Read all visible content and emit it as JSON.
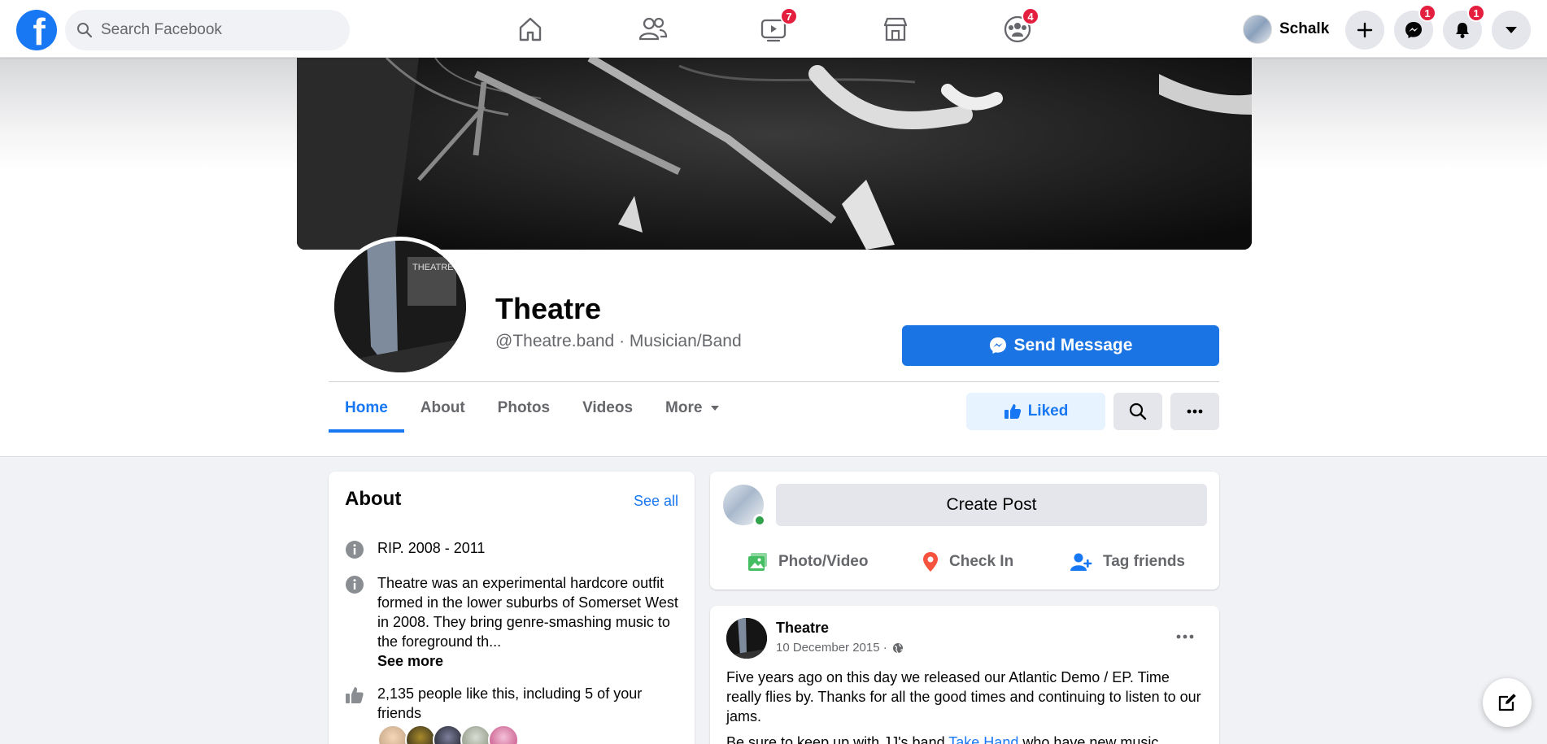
{
  "topnav": {
    "logo_letter": "f",
    "search_placeholder": "Search Facebook",
    "watch_badge": "7",
    "groups_badge": "4",
    "user_name": "Schalk",
    "messenger_badge": "1",
    "notifications_badge": "1"
  },
  "profile": {
    "name": "Theatre",
    "subtitle": "@Theatre.band · Musician/Band",
    "send_message": "Send Message",
    "cover_tag": "THEATRE"
  },
  "tabs": [
    "Home",
    "About",
    "Photos",
    "Videos",
    "More"
  ],
  "actions": {
    "liked": "Liked"
  },
  "about": {
    "title": "About",
    "see_all": "See all",
    "rip": "RIP. 2008 - 2011",
    "description": "Theatre was an experimental hardcore outfit formed in the lower suburbs of Somerset West in 2008. They bring genre-smashing music to the foreground th...",
    "see_more": "See more",
    "likes": "2,135 people like this, including 5 of your friends"
  },
  "composer": {
    "create_post": "Create Post",
    "photo_video": "Photo/Video",
    "check_in": "Check In",
    "tag_friends": "Tag friends"
  },
  "post": {
    "author": "Theatre",
    "date": "10 December 2015 ·",
    "text_line": "Five years ago on this day we released our Atlantic Demo / EP. Time really flies by. Thanks for all the good times and continuing to listen to our jams.",
    "text_2a": "Be sure to keep up with JJ's band ",
    "text_2_link": "Take Hand",
    "text_2b": " who have new music"
  },
  "colors": {
    "brand": "#1877f2",
    "badge": "#e41e3f",
    "online": "#31a24c"
  }
}
